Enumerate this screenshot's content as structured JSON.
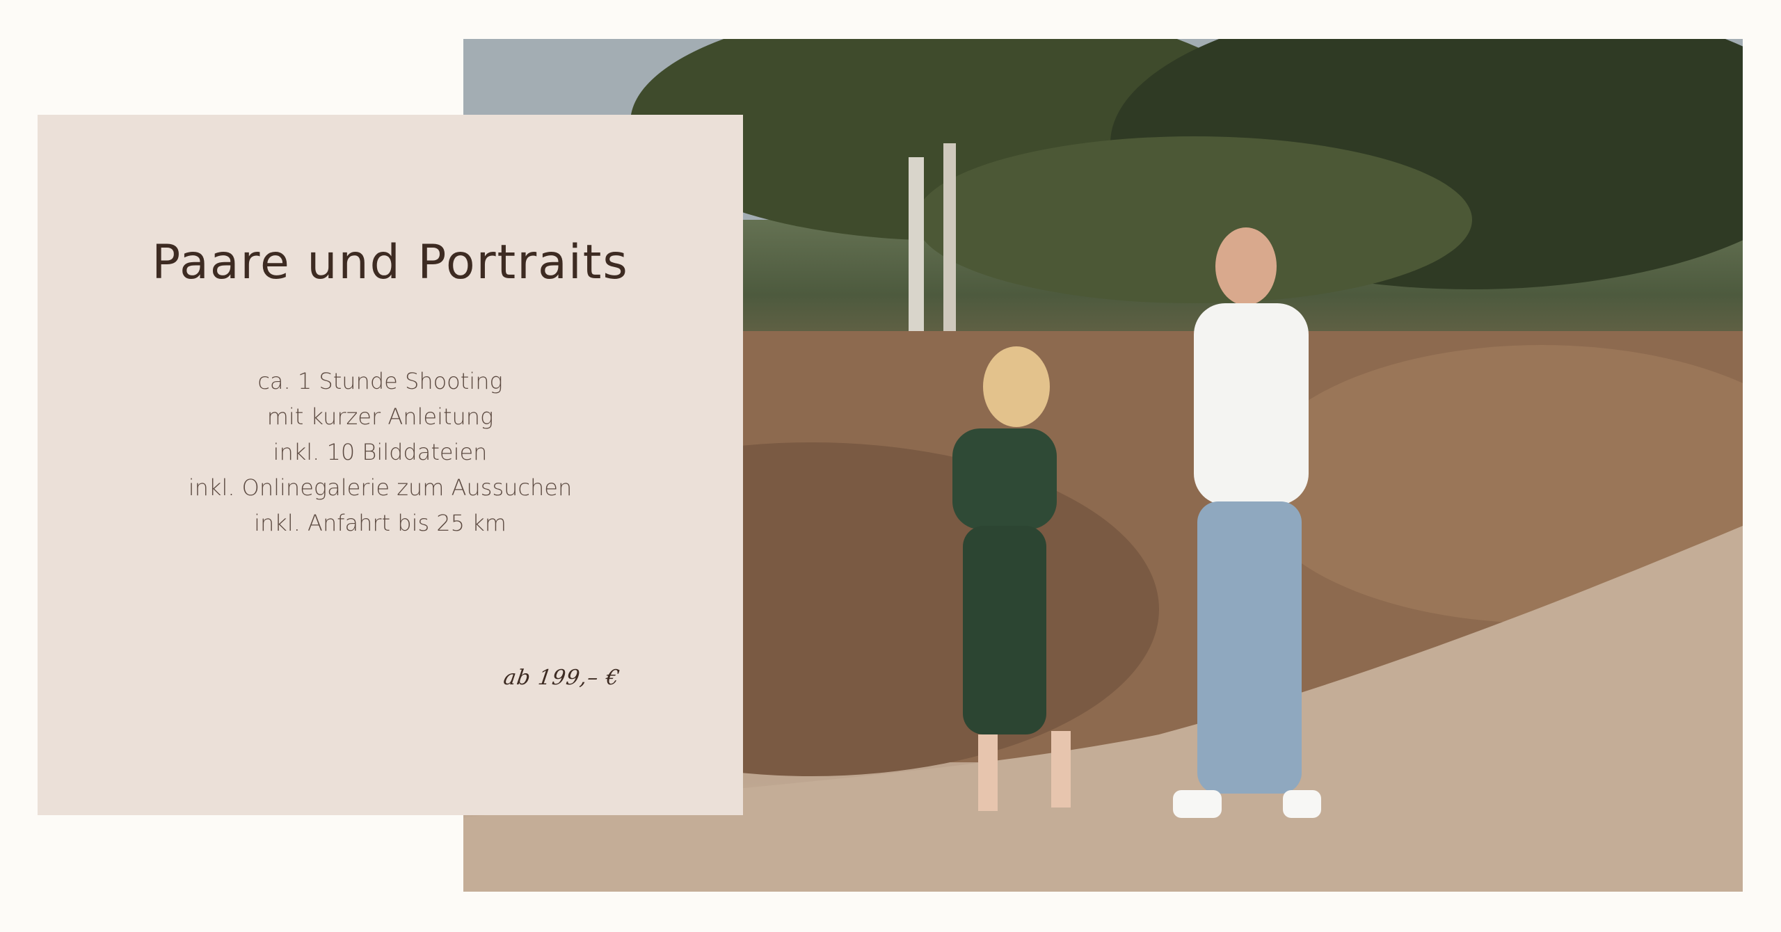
{
  "card": {
    "title": "Paare und Portraits",
    "features": [
      "ca. 1 Stunde Shooting",
      "mit kurzer Anleitung",
      "inkl. 10 Bilddateien",
      "inkl. Onlinegalerie zum Aussuchen",
      "inkl. Anfahrt bis 25 km"
    ],
    "price": "ab 199,– €"
  },
  "colors": {
    "page_background": "#fdfbf7",
    "card_background": "#ebe0d8",
    "title_text": "#3d2b22",
    "body_text": "#5c4a41"
  }
}
